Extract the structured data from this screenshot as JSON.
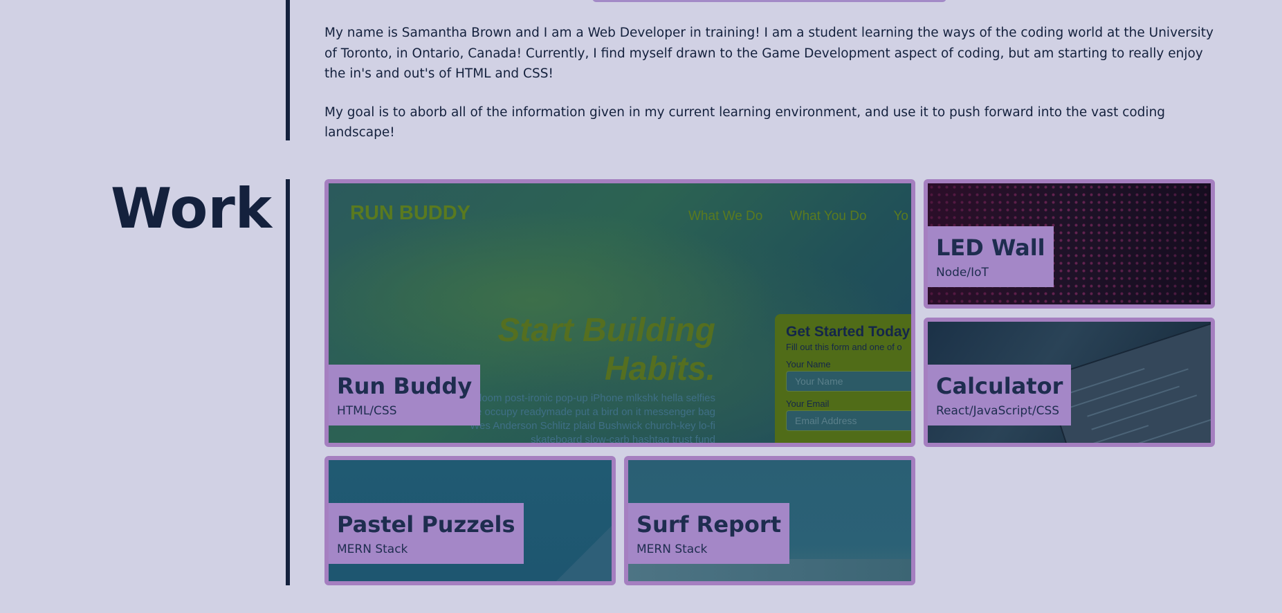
{
  "about": {
    "paragraph1": "My name is Samantha Brown and I am a Web Developer in training! I am a student learning the ways of the coding world at the University of Toronto, in Ontario, Canada! Currently, I find myself drawn to the Game Development aspect of coding, but am starting to really enjoy the in's and out's of HTML and CSS!",
    "paragraph2": "My goal is to aborb all of the information given in my current learning environment, and use it to push forward into the vast coding landscape!"
  },
  "work": {
    "heading": "Work",
    "projects": [
      {
        "title": "Run Buddy",
        "tech": "HTML/CSS",
        "screenshot": {
          "logo": "RUN BUDDY",
          "nav": [
            "What We Do",
            "What You Do",
            "Yo"
          ],
          "headline": "Start Building Habits.",
          "body": "seitan heirloom post-ironic pop-up iPhone mlkshk hella selfies fashion axe occupy readymade put a bird on it messenger bag Wes Anderson Schlitz plaid Bushwick church-key lo-fi skateboard slow-carb hashtag trust fund",
          "form_title": "Get Started Today",
          "form_sub": "Fill out this form and one of o",
          "name_label": "Your Name",
          "name_placeholder": "Your Name",
          "email_label": "Your Email",
          "email_placeholder": "Email Address"
        }
      },
      {
        "title": "LED Wall",
        "tech": "Node/IoT"
      },
      {
        "title": "Calculator",
        "tech": "React/JavaScript/CSS"
      },
      {
        "title": "Pastel Puzzels",
        "tech": "MERN Stack"
      },
      {
        "title": "Surf Report",
        "tech": "MERN Stack"
      }
    ]
  },
  "colors": {
    "background": "#d1d1e4",
    "text": "#14213d",
    "card_border": "#a57fc0",
    "label_bg": "#a487c7"
  }
}
